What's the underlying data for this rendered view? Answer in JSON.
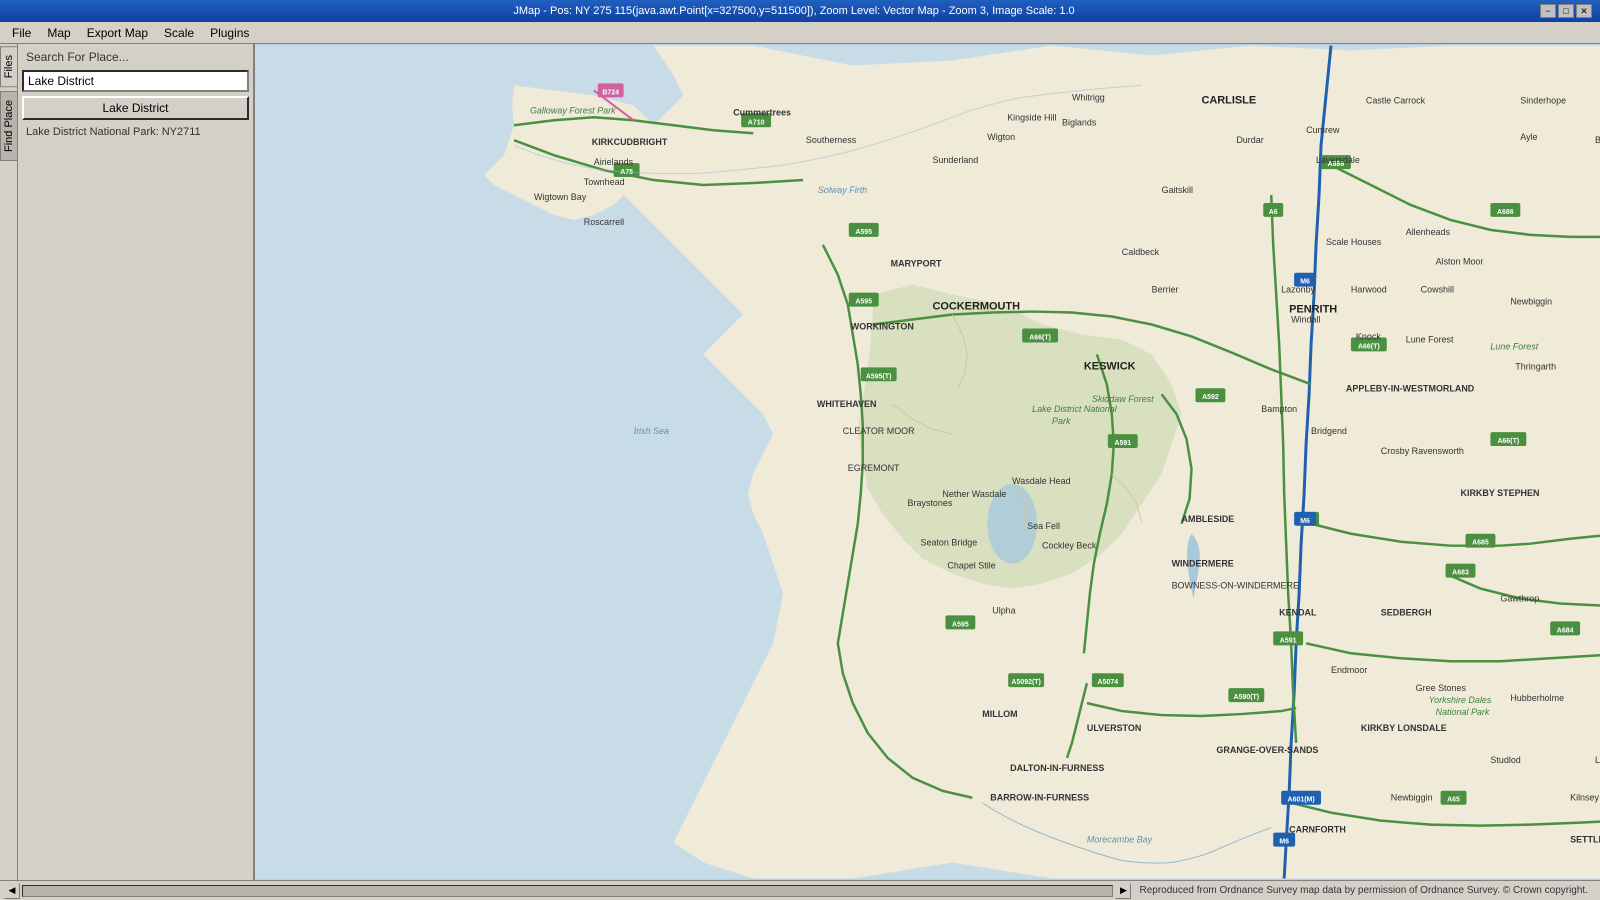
{
  "titlebar": {
    "title": "JMap - Pos: NY 275 115(java.awt.Point[x=327500,y=511500]), Zoom Level: Vector Map - Zoom 3, Image Scale: 1.0",
    "minimize": "−",
    "maximize": "□",
    "close": "✕"
  },
  "menubar": {
    "items": [
      "File",
      "Map",
      "Export Map",
      "Scale",
      "Plugins"
    ]
  },
  "sidebar": {
    "search_label": "Search For Place...",
    "search_value": "Lake District",
    "search_button": "Lake District",
    "result": "Lake District National Park: NY2711",
    "vtabs": [
      "Files",
      "Find Place"
    ]
  },
  "statusbar": {
    "copyright": "Reproduced from Ordnance Survey map data by permission of Ordnance Survey. © Crown copyright."
  }
}
